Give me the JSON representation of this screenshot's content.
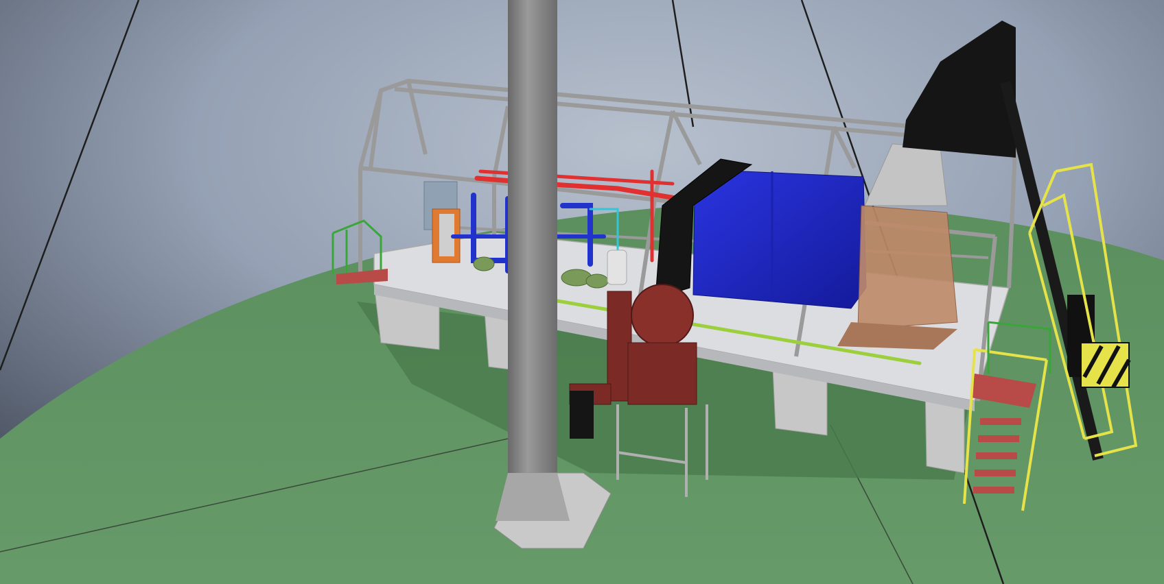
{
  "viewer": {
    "mode": "3d-model-view",
    "colors": {
      "sky_top": "#7f8ca3",
      "sky_mid": "#a9b3c3",
      "sky_dark": "#3d4452",
      "ground": "#5b8f5e",
      "ground_light": "#6a9c6c",
      "frame": "#9a9a9a",
      "platform": "#dcdde0",
      "support": "#bdbdbd",
      "boiler": "#1f27c8",
      "duct": "#151515",
      "fan": "#7b2a25",
      "conveyor": "#c08a6a",
      "ladder": "#e6e34a",
      "pipe_hot": "#e03030",
      "pipe_cold": "#2233cc",
      "pipe_green": "#9ccf3c",
      "rail_green": "#3aa63a",
      "stair_tread": "#b84a48",
      "stack": "#7d7d7d",
      "panel": "#8fa1b3",
      "exchanger": "#e07a30"
    },
    "objects": [
      {
        "name": "exhaust-stack",
        "color_ref": "stack"
      },
      {
        "name": "steel-frame",
        "color_ref": "frame"
      },
      {
        "name": "boiler-block",
        "color_ref": "boiler"
      },
      {
        "name": "flue-duct",
        "color_ref": "duct"
      },
      {
        "name": "fan-unit",
        "color_ref": "fan"
      },
      {
        "name": "fuel-conveyor",
        "color_ref": "conveyor"
      },
      {
        "name": "access-ladder",
        "color_ref": "ladder"
      },
      {
        "name": "service-stairs",
        "color_ref": "stair_tread"
      }
    ]
  }
}
